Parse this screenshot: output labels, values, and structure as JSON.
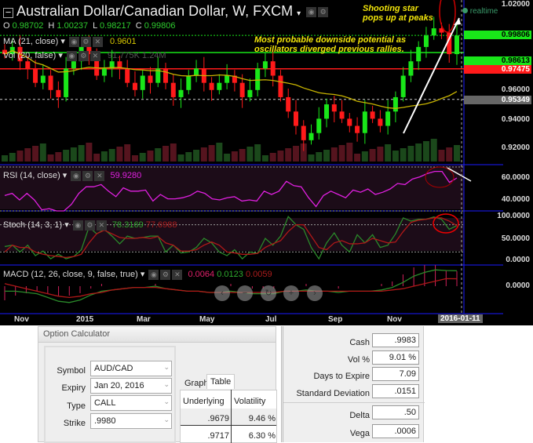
{
  "chart": {
    "title": "Australian Dollar/Canadian Dollar, W, FXCM",
    "ohlc": {
      "o_label": "O",
      "o": "0.98702",
      "h_label": "H",
      "h": "1.00237",
      "l_label": "L",
      "l": "0.98217",
      "c_label": "C",
      "c": "0.99806"
    },
    "ma": {
      "label": "MA (21, close)",
      "value": "0.9601"
    },
    "vol": {
      "label": "Vol (20, false)",
      "value": "91.775K",
      "value2": "1.24M"
    },
    "rsi": {
      "label": "RSI (14, close)",
      "value": "59.9280"
    },
    "stoch": {
      "label": "Stoch (14, 3, 1)",
      "k": "78.3169",
      "d": "77.6988"
    },
    "macd": {
      "label": "MACD (12, 26, close, 9, false, true)",
      "v1": "0.0064",
      "v2": "0.0123",
      "v3": "0.0059"
    },
    "realtime": "realtime",
    "annotations": {
      "shooting_star": [
        "Shooting star",
        "pops up at peaks"
      ],
      "downside": [
        "Most probable downside potential as",
        "oscillators diverged previous rallies."
      ]
    },
    "price_axis": [
      "1.02000",
      "0.96000",
      "0.94000",
      "0.92000"
    ],
    "price_markers": {
      "close": "0.99806",
      "support1": "0.98613",
      "support2": "0.97475",
      "ma": "0.95349"
    },
    "rsi_axis": [
      "60.0000",
      "40.0000"
    ],
    "stoch_axis": [
      "100.0000",
      "50.0000",
      "0.0000"
    ],
    "macd_axis": [
      "0.0000"
    ],
    "time_axis": [
      "Nov",
      "2015",
      "Mar",
      "May",
      "Jul",
      "Sep",
      "Nov"
    ],
    "crosshair_date": "2016-01-11",
    "nav": [
      "‹",
      "−",
      "↻",
      "+",
      "›"
    ],
    "colors": {
      "up": "#19e619",
      "down": "#ff1a1a",
      "ma": "#c8b400",
      "rsi": "#e020e0"
    }
  },
  "chart_data": {
    "type": "candlestick",
    "closes": [
      0.985,
      0.99,
      0.98,
      0.975,
      0.965,
      0.97,
      0.96,
      0.955,
      0.975,
      0.98,
      0.99,
      0.985,
      0.97,
      0.975,
      0.98,
      0.975,
      0.965,
      0.96,
      0.97,
      0.965,
      0.975,
      0.965,
      0.955,
      0.96,
      0.97,
      0.975,
      0.965,
      0.96,
      0.965,
      0.97,
      0.965,
      0.955,
      0.96,
      0.975,
      0.98,
      0.97,
      0.955,
      0.945,
      0.935,
      0.925,
      0.93,
      0.94,
      0.95,
      0.945,
      0.94,
      0.935,
      0.93,
      0.945,
      0.94,
      0.935,
      0.945,
      0.955,
      0.97,
      0.98,
      0.99,
      0.998,
      1.003,
      1.0,
      0.985,
      0.998
    ],
    "rsi": [
      44,
      46,
      40,
      46,
      40,
      31,
      32,
      30,
      30,
      36,
      46,
      52,
      52,
      54,
      48,
      43,
      51,
      48,
      48,
      49,
      39,
      45,
      41,
      41,
      42,
      44,
      48,
      46,
      41,
      40,
      42,
      43,
      39,
      40,
      39,
      48,
      45,
      48,
      57,
      53,
      52,
      42,
      34,
      44,
      48,
      45,
      42,
      49,
      47,
      50,
      45,
      47,
      50,
      55,
      54,
      59,
      61,
      64,
      66,
      66,
      56,
      60
    ],
    "stoch_k": [
      32,
      35,
      20,
      35,
      12,
      22,
      5,
      15,
      5,
      10,
      25,
      75,
      60,
      70,
      55,
      38,
      55,
      50,
      52,
      55,
      55,
      20,
      35,
      18,
      20,
      30,
      50,
      40,
      20,
      12,
      25,
      5,
      20,
      17,
      50,
      35,
      55,
      98,
      80,
      70,
      30,
      5,
      40,
      62,
      35,
      20,
      58,
      40,
      58,
      30,
      35,
      60,
      95,
      88,
      92,
      92,
      97,
      92,
      70,
      78
    ],
    "stoch_d": [
      20,
      35,
      30,
      30,
      20,
      15,
      12,
      10,
      8,
      10,
      15,
      40,
      60,
      68,
      60,
      52,
      50,
      50,
      52,
      50,
      54,
      40,
      35,
      22,
      22,
      25,
      35,
      42,
      35,
      20,
      18,
      15,
      15,
      17,
      30,
      38,
      45,
      65,
      80,
      80,
      55,
      30,
      25,
      40,
      45,
      38,
      38,
      40,
      50,
      45,
      40,
      42,
      65,
      85,
      90,
      92,
      95,
      95,
      88,
      78
    ],
    "macd_line": [
      -0.004,
      -0.004,
      -0.005,
      -0.006,
      -0.009,
      -0.012,
      -0.013,
      -0.011,
      -0.007,
      -0.004,
      -0.003,
      -0.002,
      -0.001,
      -0.001,
      0.0,
      -0.002,
      -0.003,
      -0.004,
      -0.004,
      -0.005,
      -0.005,
      -0.004,
      -0.005,
      -0.006,
      -0.006,
      -0.006,
      -0.004,
      -0.004,
      -0.003,
      -0.004,
      -0.004,
      -0.005,
      -0.004,
      -0.004,
      -0.004,
      -0.003,
      -0.001,
      0.003,
      0.008,
      0.011,
      0.013,
      0.0125,
      0.0123
    ],
    "macd_signal": [
      0.002,
      0.0,
      -0.002,
      -0.004,
      -0.006,
      -0.008,
      -0.009,
      -0.008,
      -0.006,
      -0.005,
      -0.003,
      -0.002,
      -0.001,
      -0.001,
      -0.001,
      -0.002,
      -0.003,
      -0.004,
      -0.004,
      -0.005,
      -0.005,
      -0.005,
      -0.005,
      -0.005,
      -0.005,
      -0.005,
      -0.004,
      -0.004,
      -0.004,
      -0.004,
      -0.004,
      -0.004,
      -0.004,
      -0.004,
      -0.004,
      -0.004,
      -0.003,
      -0.002,
      0.0,
      0.002,
      0.004,
      0.006,
      0.0059
    ],
    "ylim": [
      0.915,
      1.021
    ]
  },
  "calculator": {
    "title": "Option Calculator",
    "fields": [
      {
        "label": "Symbol",
        "value": "AUD/CAD"
      },
      {
        "label": "Expiry",
        "value": "Jan 20, 2016"
      },
      {
        "label": "Type",
        "value": "CALL"
      },
      {
        "label": "Strike",
        "value": ".9980"
      }
    ],
    "tabs": [
      "Graph",
      "Table"
    ],
    "table": {
      "headers": [
        "Underlying",
        "Volatility"
      ],
      "rows": [
        [
          ".9679",
          "9.46 %"
        ],
        [
          ".9717",
          "6.30 %"
        ]
      ]
    },
    "outputs": [
      {
        "label": "Cash",
        "value": ".9983"
      },
      {
        "label": "Vol %",
        "value": "9.01 %"
      },
      {
        "label": "Days to Expire",
        "value": "7.09"
      },
      {
        "label": "Standard Deviation",
        "value": ".0151"
      },
      {
        "label": "Delta",
        "value": ".50"
      },
      {
        "label": "Vega",
        "value": ".0006"
      }
    ]
  }
}
